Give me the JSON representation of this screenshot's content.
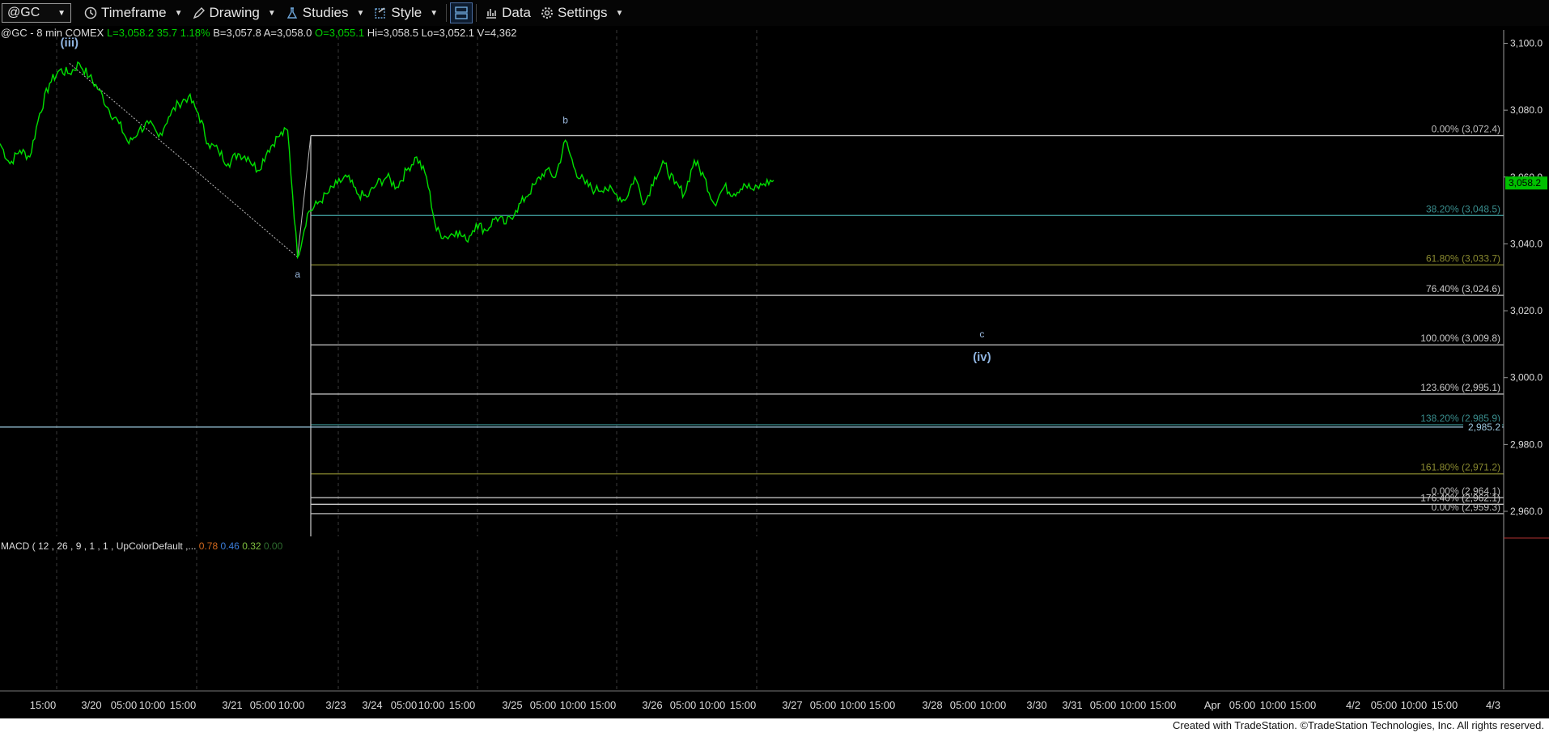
{
  "toolbar": {
    "symbol": "@GC",
    "timeframe": "Timeframe",
    "drawing": "Drawing",
    "studies": "Studies",
    "style": "Style",
    "data": "Data",
    "settings": "Settings"
  },
  "header": {
    "symbol_info": "@GC - 8 min  COMEX",
    "last": "L=3,058.2",
    "change": "35.7",
    "change_pct": "1.18%",
    "bid": "B=3,057.8",
    "ask": "A=3,058.0",
    "open": "O=3,055.1",
    "high": "Hi=3,058.5",
    "low": "Lo=3,052.1",
    "volume": "V=4,362"
  },
  "macd": {
    "label": "MACD ( 12 , 26 , 9 , 1 , 1 , UpColorDefault ,...",
    "values": [
      "0.78",
      "0.46",
      "0.32",
      "0.00"
    ],
    "colors": [
      "#d2691e",
      "#3b7dd8",
      "#7fbf3f",
      "#2e6b2e"
    ]
  },
  "footer": {
    "credit": "Created with TradeStation. ©TradeStation Technologies, Inc. All rights reserved."
  },
  "colors": {
    "price": "#00e000",
    "background": "#000000",
    "fib_default": "#c0c0c0",
    "last_price": "#00c000"
  },
  "chart_data": {
    "type": "line",
    "title": "@GC - 8 min COMEX",
    "ylim": [
      2952.5,
      3104.0
    ],
    "y_ticks": [
      3100.0,
      3080.0,
      3060.0,
      3040.0,
      3020.0,
      3000.0,
      2980.0,
      2960.0
    ],
    "y_tick_labels": [
      "3,100.0",
      "3,080.0",
      "3,060.0",
      "3,040.0",
      "3,020.0",
      "3,000.0",
      "2,980.0",
      "2,960.0"
    ],
    "x_tick_labels": [
      "15:00",
      "3/20",
      "05:00",
      "10:00",
      "15:00",
      "3/21",
      "05:00",
      "10:00",
      "3/23",
      "3/24",
      "05:00",
      "10:00",
      "15:00",
      "3/25",
      "05:00",
      "10:00",
      "15:00",
      "3/26",
      "05:00",
      "10:00",
      "15:00",
      "3/27",
      "05:00",
      "10:00",
      "15:00",
      "3/28",
      "05:00",
      "10:00",
      "3/30",
      "3/31",
      "05:00",
      "10:00",
      "15:00",
      "Apr",
      "05:00",
      "10:00",
      "15:00",
      "4/2",
      "05:00",
      "10:00",
      "15:00",
      "4/3"
    ],
    "series": [
      {
        "values": [
          3070,
          3064,
          3068,
          3066,
          3079,
          3088,
          3092,
          3091,
          3094,
          3090,
          3086,
          3080,
          3076,
          3070,
          3074,
          3076,
          3072,
          3078,
          3082,
          3084,
          3079,
          3070,
          3068,
          3064,
          3067,
          3066,
          3062,
          3068,
          3072,
          3074,
          3036,
          3049,
          3052,
          3055,
          3058,
          3060,
          3055,
          3054,
          3058,
          3060,
          3057,
          3062,
          3066,
          3060,
          3044,
          3042,
          3044,
          3041,
          3046,
          3044,
          3048,
          3046,
          3050,
          3054,
          3058,
          3062,
          3060,
          3071,
          3062,
          3058,
          3056,
          3057,
          3055,
          3053,
          3060,
          3052,
          3060,
          3064,
          3058,
          3055,
          3065,
          3060,
          3052,
          3057,
          3055,
          3058,
          3056,
          3058,
          3059
        ]
      }
    ],
    "last_price": 3058.2,
    "last_price_label": "3,058.2",
    "horizontal_line": {
      "value": 2985.2,
      "label": "2,985.2"
    },
    "fib_levels": [
      {
        "label": "0.00% (3,072.4)",
        "value": 3072.4,
        "color": "#bdbdbd"
      },
      {
        "label": "38.20% (3,048.5)",
        "value": 3048.5,
        "color": "#3a8f8f"
      },
      {
        "label": "61.80% (3,033.7)",
        "value": 3033.7,
        "color": "#8a8a30"
      },
      {
        "label": "76.40% (3,024.6)",
        "value": 3024.6,
        "color": "#c8c8c8"
      },
      {
        "label": "100.00% (3,009.8)",
        "value": 3009.8,
        "color": "#c8c8c8"
      },
      {
        "label": "123.60% (2,995.1)",
        "value": 2995.1,
        "color": "#c8c8c8"
      },
      {
        "label": "138.20% (2,985.9)",
        "value": 2985.9,
        "color": "#3a8f8f"
      },
      {
        "label": "161.80% (2,971.2)",
        "value": 2971.2,
        "color": "#8a8a30"
      },
      {
        "label": "0.00% (2,964.1)",
        "value": 2964.1,
        "color": "#bdbdbd"
      },
      {
        "label": "176.40% (2,962.1)",
        "value": 2962.1,
        "color": "#c8c8c8"
      },
      {
        "label": "0.00% (2,959.3)",
        "value": 2959.3,
        "color": "#bdbdbd"
      }
    ],
    "wave_labels": [
      {
        "text": "(iii)",
        "value": 3099.0,
        "index": 7
      },
      {
        "text": "a",
        "value": 3030.0,
        "index": 30
      },
      {
        "text": "b",
        "value": 3076.0,
        "index": 57
      },
      {
        "text": "c",
        "value": 3012.0,
        "index": 99
      },
      {
        "text": "(iv)",
        "value": 3005.0,
        "index": 99
      }
    ]
  }
}
